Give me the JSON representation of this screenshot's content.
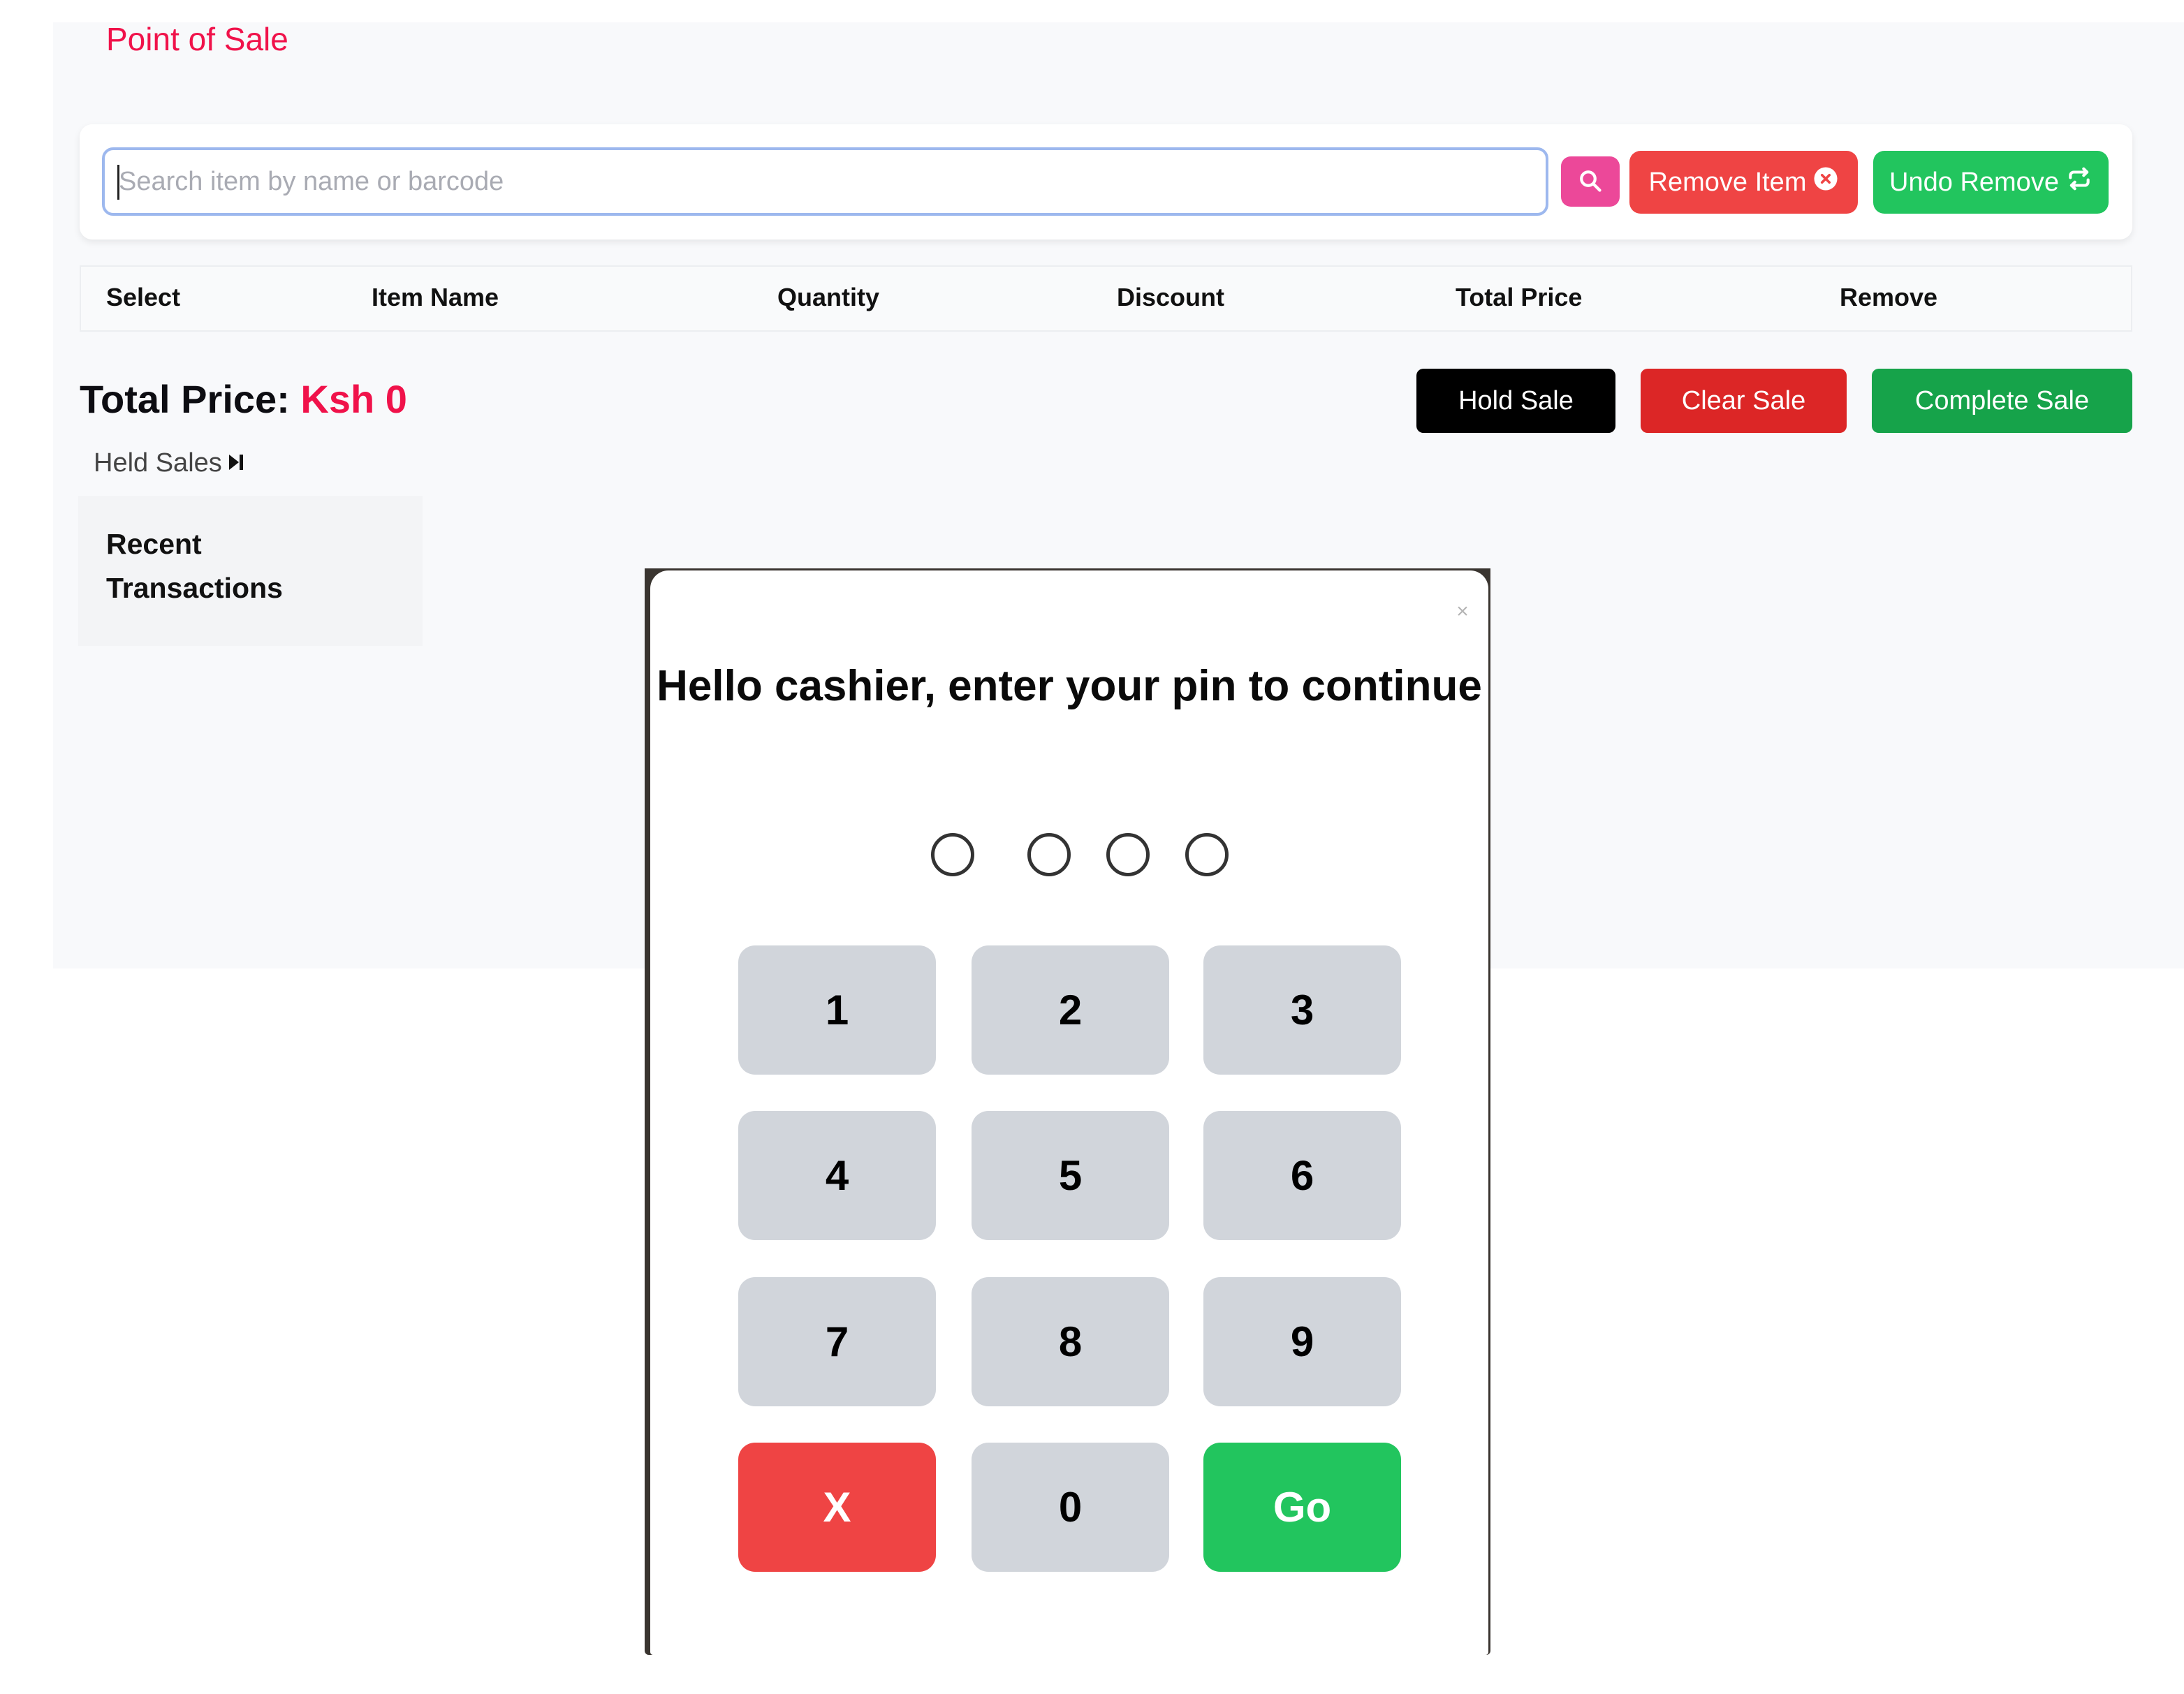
{
  "app": {
    "title": "Point of Sale"
  },
  "search": {
    "placeholder": "Search item by name or barcode",
    "value": "",
    "search_icon": "search-icon",
    "remove_item_label": "Remove Item",
    "remove_item_icon": "circle-x-icon",
    "undo_remove_label": "Undo Remove",
    "undo_remove_icon": "repeat-arrows-icon"
  },
  "table": {
    "columns": [
      "Select",
      "Item Name",
      "Quantity",
      "Discount",
      "Total Price",
      "Remove"
    ],
    "rows": []
  },
  "totals": {
    "label": "Total Price:",
    "value": "Ksh 0"
  },
  "actions": {
    "hold_label": "Hold Sale",
    "clear_label": "Clear Sale",
    "complete_label": "Complete Sale"
  },
  "held_sales": {
    "label": "Held Sales",
    "icon": "step-forward-icon"
  },
  "recent": {
    "title": "Recent Transactions"
  },
  "pin_modal": {
    "close_label": "×",
    "title": "Hello cashier, enter your pin to continue",
    "pin_length": 4,
    "pin_entered": 0,
    "keys": [
      "1",
      "2",
      "3",
      "4",
      "5",
      "6",
      "7",
      "8",
      "9",
      "X",
      "0",
      "Go"
    ]
  },
  "colors": {
    "brand": "#f0124a",
    "search_button": "#ec4899",
    "danger": "#ef4444",
    "success": "#22c55e",
    "clear_sale": "#dc2626",
    "complete_sale": "#16a34a",
    "hold_sale": "#000000",
    "keypad_key": "#d1d5db"
  }
}
